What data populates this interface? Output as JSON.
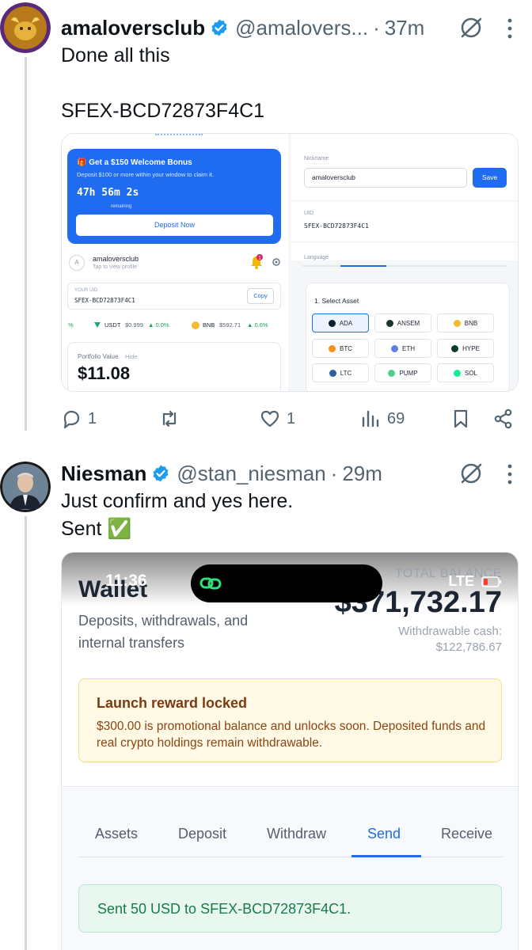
{
  "tweet1": {
    "name": "amaloversclub",
    "handle": "@amalovers...",
    "dot": "·",
    "time": "37m",
    "text": "Done all this\n\nSFEX-BCD72873F4C1",
    "media": {
      "bonus": {
        "title": "🎁 Get a $150 Welcome Bonus",
        "subtitle": "Deposit $100 or more within your window to claim it.",
        "timer": "47h 56m 2s",
        "remaining": "remaining",
        "deposit_button": "Deposit Now"
      },
      "profile": {
        "avatar_letter": "A",
        "name": "amaloversclub",
        "subtitle": "Tap to view profile",
        "notification_count": "1"
      },
      "uid_box": {
        "label": "YOUR UID",
        "value": "SFEX-BCD72873F4C1",
        "copy_button": "Copy"
      },
      "tickers": {
        "pct_partial": "%",
        "usdt": "USDT",
        "usdt_price": "$0.999",
        "usdt_change": "▲ 0.0%",
        "bnb": "BNB",
        "bnb_price": "$592.71",
        "bnb_change": "▲ 0.6%"
      },
      "portfolio": {
        "label": "Portfolio Value",
        "hide": "Hide",
        "value": "$11.08"
      },
      "settings": {
        "nickname_label": "Nickname",
        "nickname_value": "amaloversclub",
        "save_button": "Save",
        "uid_label": "UID",
        "uid_value": "SFEX-BCD72873F4C1",
        "language_label": "Language"
      },
      "assets": {
        "title": "1. Select Asset",
        "items": [
          "ADA",
          "ANSEM",
          "BNB",
          "BTC",
          "ETH",
          "HYPE",
          "LTC",
          "PUMP",
          "SOL"
        ],
        "selected": "ADA"
      }
    },
    "stats": {
      "replies": "1",
      "retweets": "",
      "likes": "1",
      "views": "69"
    }
  },
  "tweet2": {
    "name": "Niesman",
    "handle": "@stan_niesman",
    "dot": "·",
    "time": "29m",
    "text": "Just confirm and yes here.\nSent ✅",
    "media": {
      "status_time": "11:36",
      "status_right": "LTE",
      "wallet_title": "Wallet",
      "wallet_subtitle": "Deposits, withdrawals, and internal transfers",
      "total_label": "TOTAL BALANCE",
      "total_value": "$371,732.17",
      "withdrawable_label": "Withdrawable cash:",
      "withdrawable_value": "$122,786.67",
      "locked_title": "Launch reward locked",
      "locked_text": "$300.00 is promotional balance and unlocks soon. Deposited funds and real crypto holdings remain withdrawable.",
      "tabs": [
        "Assets",
        "Deposit",
        "Withdraw",
        "Send",
        "Receive"
      ],
      "active_tab": "Send",
      "sent_message": "Sent 50 USD to SFEX-BCD72873F4C1."
    }
  },
  "colors": {
    "verified": "#1d9bf0",
    "accent": "#1f6cf0",
    "muted": "#536471"
  }
}
